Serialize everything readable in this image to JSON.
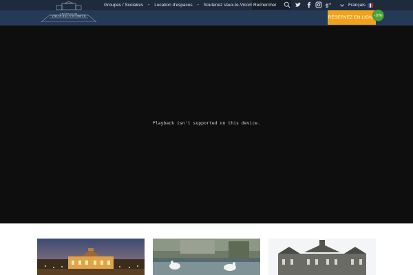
{
  "header": {
    "logo": {
      "line1": "CHÂTEAU DE",
      "line2": "VAUX-LE-VICOMTE"
    },
    "nav": [
      {
        "label": "Groupes / Scolaires"
      },
      {
        "label": "Location d'espaces"
      },
      {
        "label": "Soutenez Vaux-le-Vicomte"
      }
    ],
    "search": {
      "placeholder": "Rechercher",
      "icon": "search-icon"
    },
    "social": [
      {
        "icon": "twitter-icon"
      },
      {
        "icon": "facebook-icon"
      },
      {
        "icon": "instagram-icon"
      },
      {
        "icon": "google-plus-icon"
      }
    ],
    "language": {
      "label": "Français",
      "flag": "french-flag"
    },
    "cta": {
      "label": "RÉSERVEZ EN LIGNE",
      "badge": "-10%"
    }
  },
  "video": {
    "message": "Playback isn't supported on this device."
  },
  "colors": {
    "header_dark": "#1e2b3c",
    "header_blue": "#243a57",
    "cta_orange": "#f0a21c",
    "badge_green": "#4aa63a",
    "video_bg": "#0e0e0e"
  },
  "cards": [
    {
      "image": "chateau-illuminated-at-dusk"
    },
    {
      "image": "fountain-gardens-with-swans"
    },
    {
      "image": "chateau-facade-daytime"
    }
  ]
}
